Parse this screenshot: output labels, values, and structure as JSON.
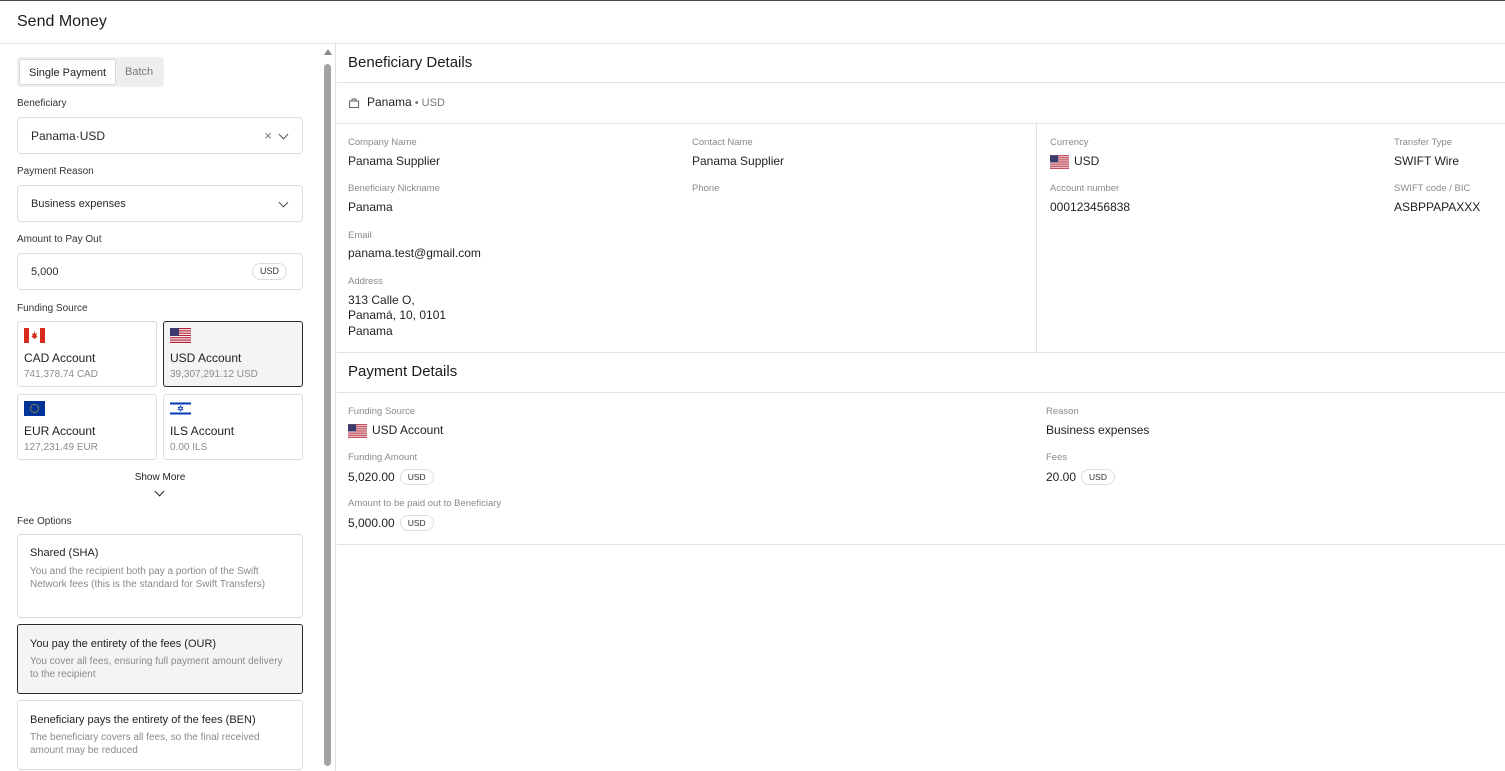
{
  "header": {
    "title": "Send Money"
  },
  "left": {
    "tabs": [
      {
        "label": "Single Payment",
        "active": true
      },
      {
        "label": "Batch",
        "active": false
      }
    ],
    "beneficiary": {
      "label": "Beneficiary",
      "value": "Panama·USD"
    },
    "payment_reason": {
      "label": "Payment Reason",
      "value": "Business expenses"
    },
    "amount": {
      "label": "Amount to Pay Out",
      "value": "5,000",
      "currency": "USD"
    },
    "funding_source": {
      "label": "Funding Source",
      "accounts": [
        {
          "name": "CAD Account",
          "balance": "741,378.74 CAD",
          "flag": "canada-flag-icon",
          "selected": false
        },
        {
          "name": "USD Account",
          "balance": "39,307,291.12 USD",
          "flag": "us-flag-icon",
          "selected": true
        },
        {
          "name": "EUR Account",
          "balance": "127,231.49 EUR",
          "flag": "eu-flag-icon",
          "selected": false
        },
        {
          "name": "ILS Account",
          "balance": "0.00 ILS",
          "flag": "israel-flag-icon",
          "selected": false
        }
      ],
      "show_more": "Show More"
    },
    "fee_options": {
      "label": "Fee Options",
      "options": [
        {
          "title": "Shared (SHA)",
          "desc": "You and the recipient both pay a portion of the Swift Network fees (this is the standard for Swift Transfers)",
          "selected": false
        },
        {
          "title": "You pay the entirety of the fees (OUR)",
          "desc": "You cover all fees, ensuring full payment amount delivery to the recipient",
          "selected": true
        },
        {
          "title": "Beneficiary pays the entirety of the fees (BEN)",
          "desc": "The beneficiary covers all fees, so the final received amount may be reduced",
          "selected": false
        }
      ]
    }
  },
  "beneficiary_details": {
    "title": "Beneficiary Details",
    "subtitle_name": "Panama",
    "subtitle_currency": " • USD",
    "company_name": {
      "label": "Company Name",
      "value": "Panama Supplier"
    },
    "contact_name": {
      "label": "Contact Name",
      "value": "Panama Supplier"
    },
    "nickname": {
      "label": "Beneficiary Nickname",
      "value": "Panama"
    },
    "phone": {
      "label": "Phone",
      "value": ""
    },
    "email": {
      "label": "Email",
      "value": "panama.test@gmail.com"
    },
    "address": {
      "label": "Address",
      "line1": "313 Calle O,",
      "line2": "Panamá, 10, 0101",
      "line3": "Panama"
    },
    "currency": {
      "label": "Currency",
      "value": "USD"
    },
    "transfer_type": {
      "label": "Transfer Type",
      "value": "SWIFT Wire"
    },
    "account_number": {
      "label": "Account number",
      "value": "000123456838"
    },
    "swift": {
      "label": "SWIFT code / BIC",
      "value": "ASBPPAPAXXX"
    }
  },
  "payment_details": {
    "title": "Payment Details",
    "funding_source": {
      "label": "Funding Source",
      "value": "USD Account"
    },
    "reason": {
      "label": "Reason",
      "value": "Business expenses"
    },
    "funding_amount": {
      "label": "Funding Amount",
      "value": "5,020.00",
      "currency": "USD"
    },
    "fees": {
      "label": "Fees",
      "value": "20.00",
      "currency": "USD"
    },
    "payout": {
      "label": "Amount to be paid out to Beneficiary",
      "value": "5,000.00",
      "currency": "USD"
    }
  },
  "colors": {
    "selected_border": "#2b2b2b",
    "border": "#dcdcdc",
    "muted_text": "#8a8a8a"
  }
}
